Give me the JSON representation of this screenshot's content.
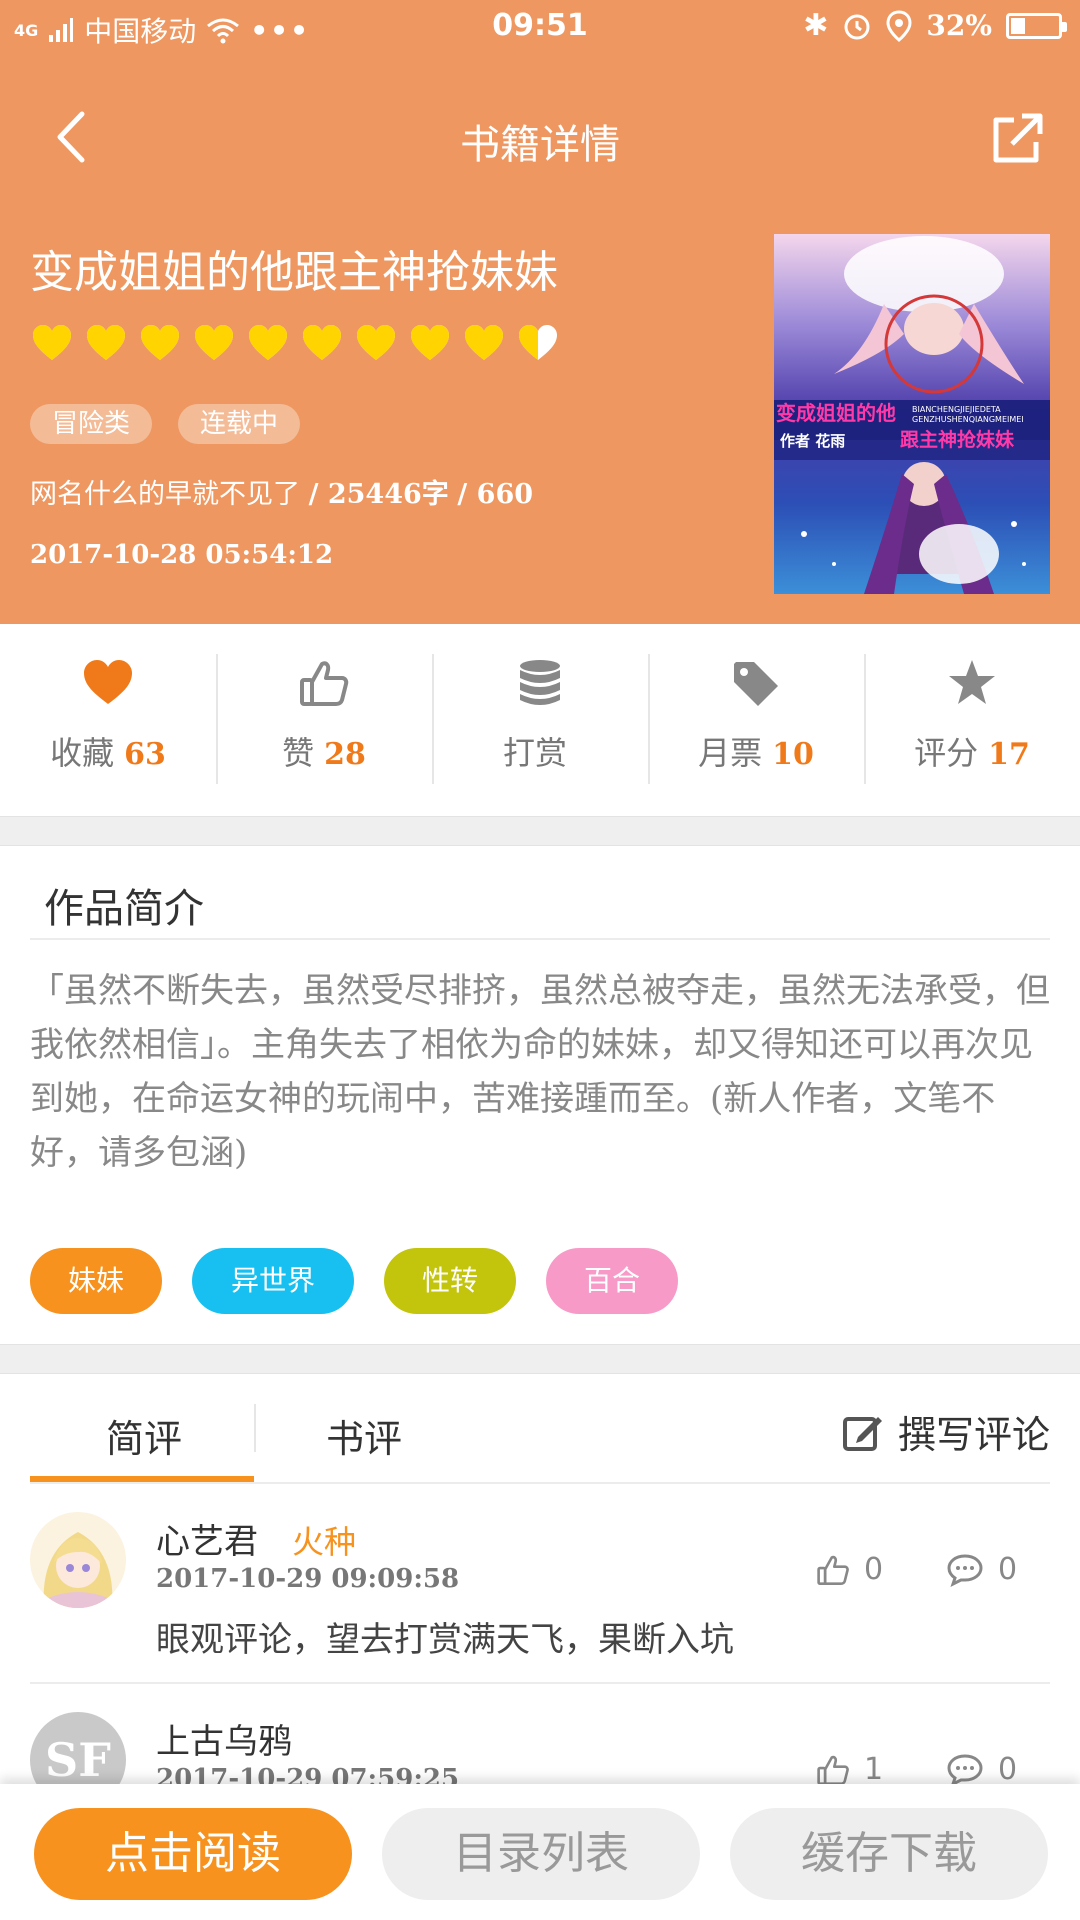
{
  "status_bar": {
    "network": "4G",
    "carrier": "中国移动",
    "time": "09:51",
    "battery": "32%",
    "battery_level": 0.32
  },
  "nav": {
    "title": "书籍详情"
  },
  "book": {
    "title": "变成姐姐的他跟主神抢妹妹",
    "rating_hearts": 9.5,
    "rating_max": 10,
    "tags": [
      "冒险类",
      "连载中"
    ],
    "author": "网名什么的早就不见了",
    "word_count": "25446字",
    "chapters": "660",
    "updated": "2017-10-28 05:54:12",
    "cover": {
      "title_line1": "变成姐姐的他",
      "title_line2": "跟主神抢妹妹",
      "author_line": "作者 花雨",
      "pinyin1": "BIANCHENGJIEJIEDETA",
      "pinyin2": "GENZHUSHENQIANGMEIMEI"
    }
  },
  "stats": [
    {
      "icon": "heart-icon",
      "label": "收藏",
      "count": "63"
    },
    {
      "icon": "thumbs-up-icon",
      "label": "赞",
      "count": "28"
    },
    {
      "icon": "coins-icon",
      "label": "打赏",
      "count": ""
    },
    {
      "icon": "tag-icon",
      "label": "月票",
      "count": "10"
    },
    {
      "icon": "star-icon",
      "label": "评分",
      "count": "17"
    }
  ],
  "synopsis": {
    "heading": "作品简介",
    "text": "「虽然不断失去，虽然受尽排挤，虽然总被夺走，虽然无法承受，但我依然相信」。主角失去了相依为命的妹妹，却又得知还可以再次见到她，在命运女神的玩闹中，苦难接踵而至。(新人作者，文笔不好，请多包涵)",
    "genres": [
      {
        "label": "妹妹",
        "color": "#f7921e"
      },
      {
        "label": "异世界",
        "color": "#17c0f0"
      },
      {
        "label": "性转",
        "color": "#c3c40c"
      },
      {
        "label": "百合",
        "color": "#f79ac8"
      }
    ]
  },
  "tabs": {
    "short_review": "简评",
    "book_review": "书评",
    "write": "撰写评论"
  },
  "comments": [
    {
      "user": "心艺君",
      "badge": "火种",
      "time": "2017-10-29 09:09:58",
      "text": "眼观评论，望去打赏满天飞，果断入坑",
      "likes": "0",
      "replies": "0"
    },
    {
      "user": "上古乌鸦",
      "badge": "",
      "time": "2017-10-29 07:59:25",
      "text": "",
      "likes": "1",
      "replies": "0"
    }
  ],
  "bottom": {
    "read": "点击阅读",
    "catalog": "目录列表",
    "download": "缓存下载"
  },
  "colors": {
    "header_bg": "#ee9760",
    "accent": "#f7921e",
    "heart_yellow": "#ffd400"
  }
}
